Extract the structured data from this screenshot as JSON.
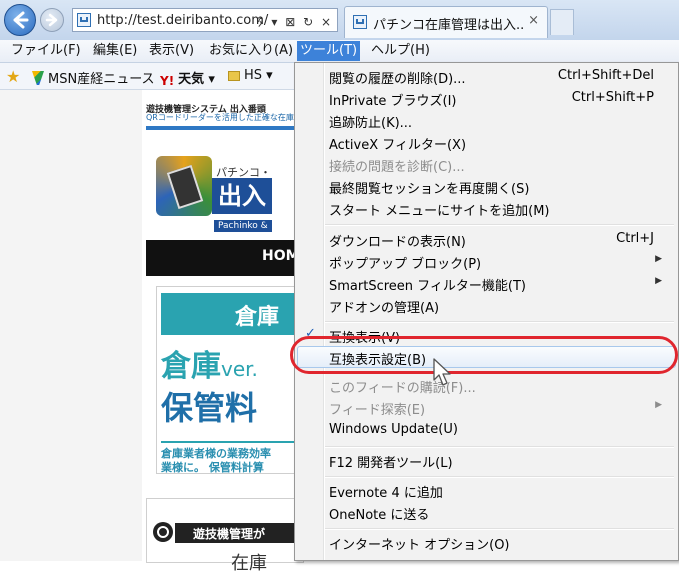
{
  "browser": {
    "address_url": "http://test.deiribanto.com/",
    "address_icons": "ﾀ ▾ ⊠ ↻ ×",
    "tab_title": "パチンコ在庫管理は出入...",
    "tab_close": "×"
  },
  "menubar": {
    "items": [
      "ファイル(F)",
      "編集(E)",
      "表示(V)",
      "お気に入り(A)",
      "ツール(T)",
      "ヘルプ(H)"
    ]
  },
  "favorites": {
    "items": [
      "MSN産経ニュース",
      "天気",
      "HS"
    ],
    "yahoo_mark": "Y!",
    "dropdown_marker": "▾"
  },
  "page": {
    "head1": "遊技機管理システム 出入番頭",
    "head2": "QRコードリーダーを活用した正確な在庫",
    "logo_small": "パチンコ・",
    "logo_big": "出入",
    "logo_en": "Pachinko &",
    "nav_home": "HOM",
    "box1_head": "倉庫",
    "box1_text1": "倉庫",
    "box1_text1_suffix": "ver.",
    "box1_text2": "保管料",
    "box1_desc1": "倉庫業者様の業務効率",
    "box1_desc2": "業様に。 保管料計算",
    "box2_title": "遊技機管理が",
    "box2_text": "在庫"
  },
  "tools_menu": {
    "items": [
      {
        "label": "閲覧の履歴の削除(D)...",
        "shortcut": "Ctrl+Shift+Del"
      },
      {
        "label": "InPrivate ブラウズ(I)",
        "shortcut": "Ctrl+Shift+P"
      },
      {
        "label": "追跡防止(K)..."
      },
      {
        "label": "ActiveX フィルター(X)"
      },
      {
        "label": "接続の問題を診断(C)...",
        "disabled": true
      },
      {
        "label": "最終閲覧セッションを再度開く(S)"
      },
      {
        "label": "スタート メニューにサイトを追加(M)"
      },
      {
        "label": "ダウンロードの表示(N)",
        "shortcut": "Ctrl+J"
      },
      {
        "label": "ポップアップ ブロック(P)",
        "submenu": true
      },
      {
        "label": "SmartScreen フィルター機能(T)",
        "submenu": true
      },
      {
        "label": "アドオンの管理(A)"
      },
      {
        "label": "互換表示(V)",
        "checked": true
      },
      {
        "label": "互換表示設定(B)",
        "highlighted": true
      },
      {
        "label": "このフィードの購読(F)...",
        "disabled": true
      },
      {
        "label": "フィード探索(E)",
        "disabled": true,
        "submenu": true
      },
      {
        "label": "Windows Update(U)"
      },
      {
        "label": "F12 開発者ツール(L)"
      },
      {
        "label": "Evernote 4 に追加"
      },
      {
        "label": "OneNote に送る"
      },
      {
        "label": "インターネット オプション(O)"
      }
    ],
    "check_mark": "✓",
    "submenu_arrow": "▶"
  }
}
